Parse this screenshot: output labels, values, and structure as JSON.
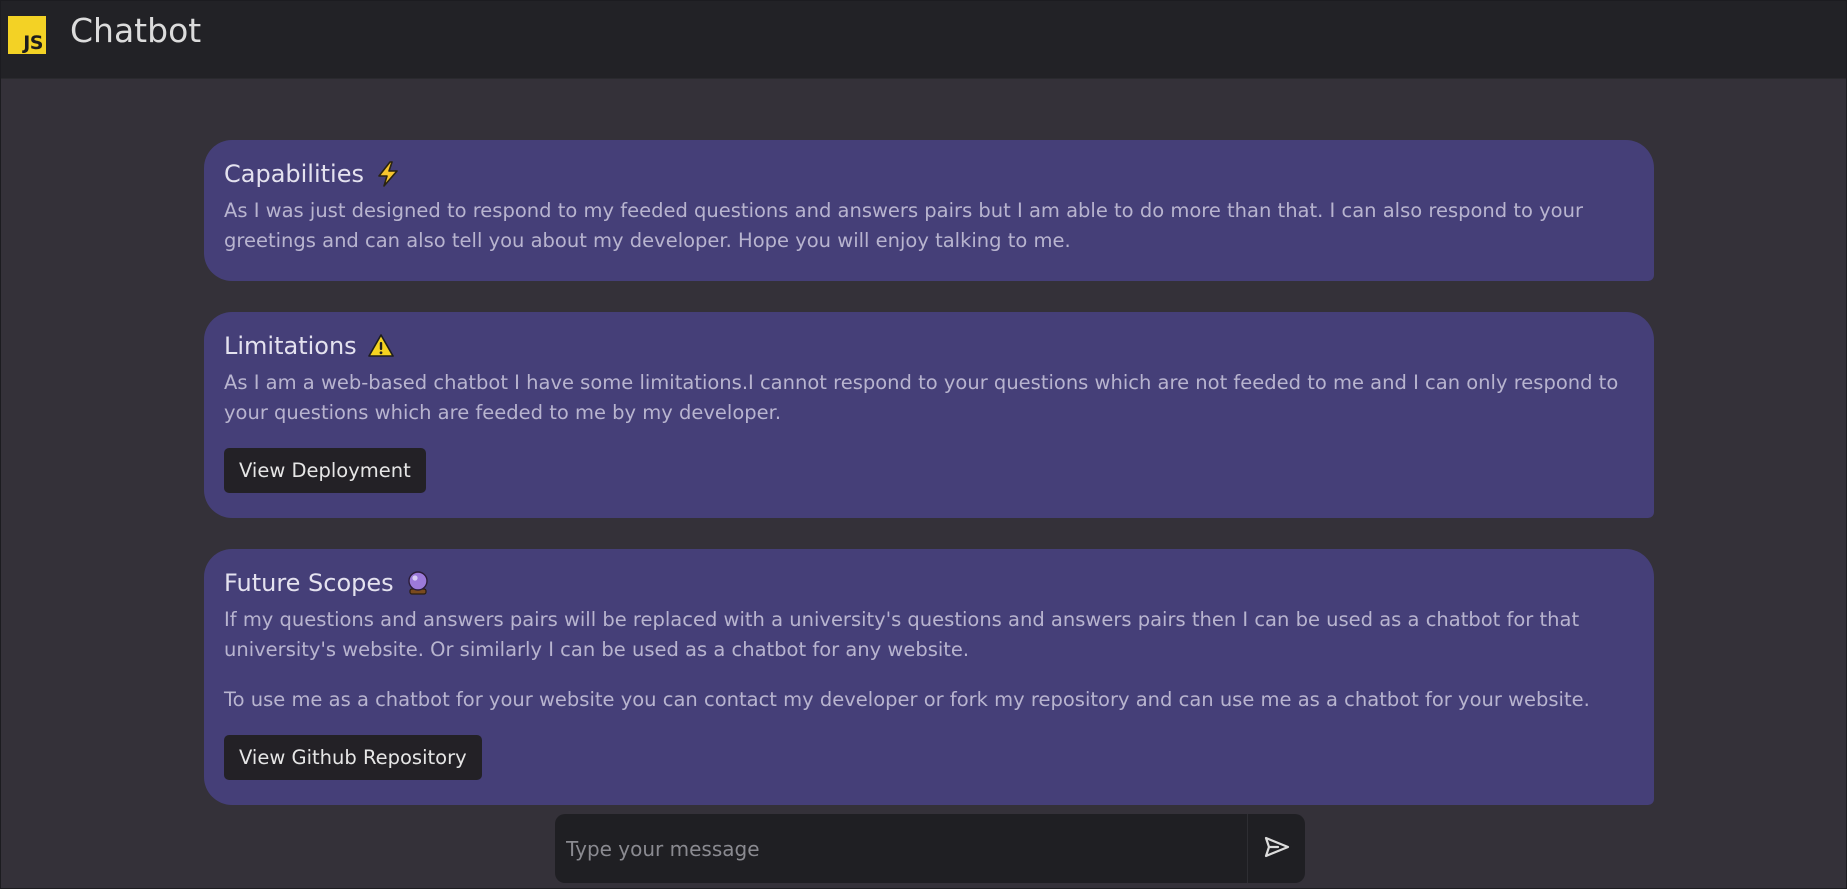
{
  "header": {
    "logo_text": "JS",
    "title": "Chatbot"
  },
  "cards": [
    {
      "title": "Capabilities",
      "icon": "lightning-icon",
      "paragraphs": [
        "As I was just designed to respond to my feeded questions and answers pairs but I am able to do more than that. I can also respond to your greetings and can also tell you about my developer. Hope you will enjoy talking to me."
      ]
    },
    {
      "title": "Limitations",
      "icon": "warning-icon",
      "paragraphs": [
        "As I am a web-based chatbot I have some limitations.I cannot respond to your questions which are not feeded to me and I can only respond to your questions which are feeded to me by my developer."
      ],
      "button_label": "View Deployment"
    },
    {
      "title": "Future Scopes",
      "icon": "crystal-ball-icon",
      "paragraphs": [
        "If my questions and answers pairs will be replaced with a university's questions and answers pairs then I can be used as a chatbot for that university's website. Or similarly I can be used as a chatbot for any website.",
        "To use me as a chatbot for your website you can contact my developer or fork my repository and can use me as a chatbot for your website."
      ],
      "button_label": "View Github Repository"
    }
  ],
  "composer": {
    "placeholder": "Type your message",
    "value": "",
    "send_icon": "send-icon"
  },
  "colors": {
    "background": "#343139",
    "header": "#222226",
    "card": "#453f78",
    "button": "#232126",
    "logo": "#f3d225"
  }
}
